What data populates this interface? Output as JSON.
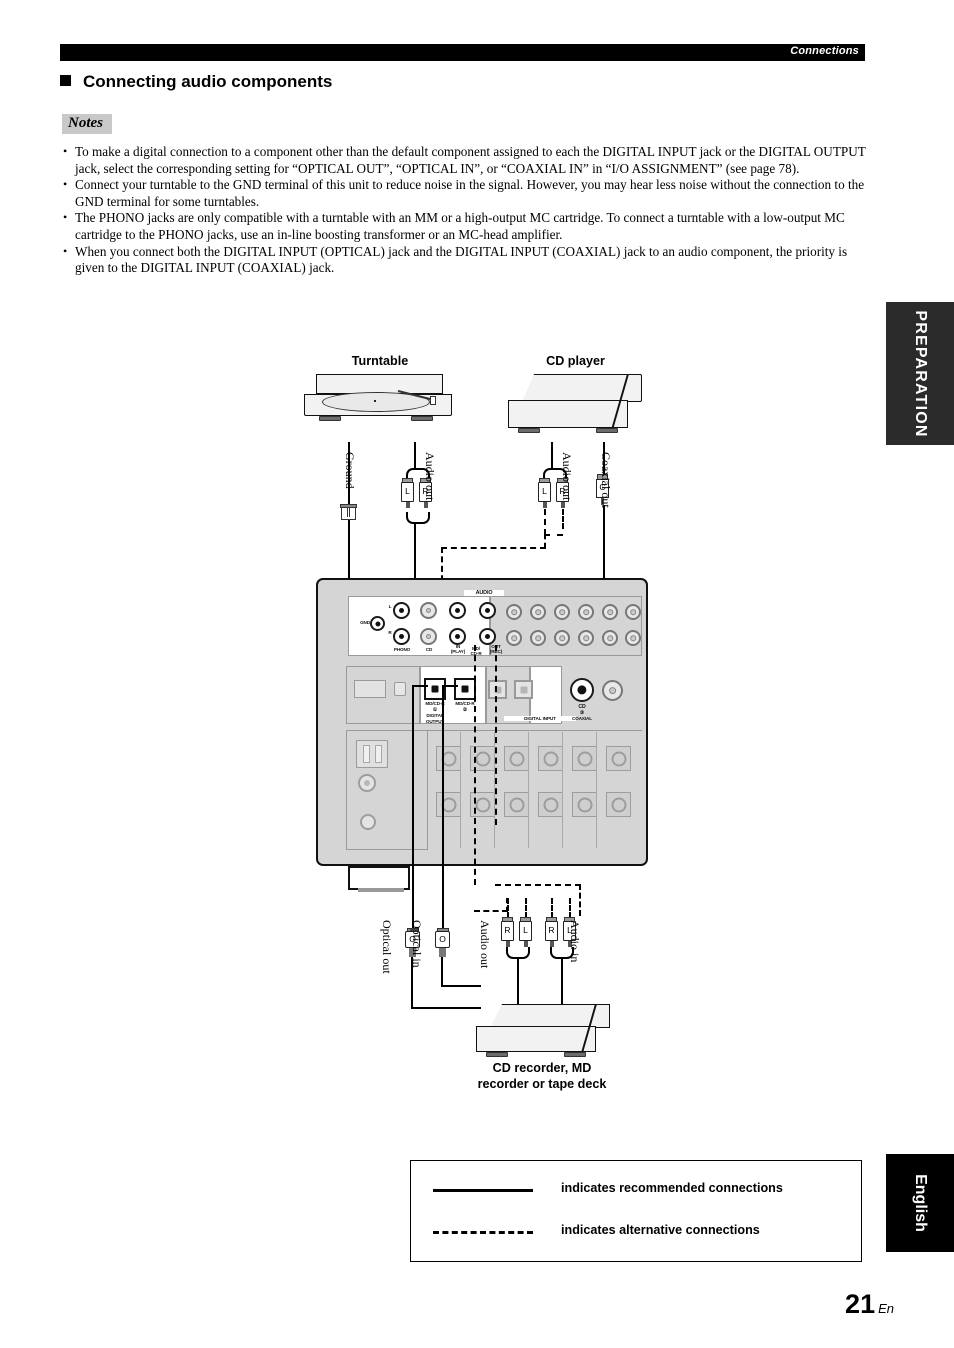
{
  "header": {
    "running_title": "Connections"
  },
  "section": {
    "title": "Connecting audio components"
  },
  "notes": {
    "label": "Notes",
    "items": [
      "To make a digital connection to a component other than the default component assigned to each the DIGITAL INPUT jack or the DIGITAL OUTPUT jack, select the corresponding setting for “OPTICAL OUT”, “OPTICAL IN”, or “COAXIAL IN” in “I/O ASSIGNMENT” (see page 78).",
      "Connect your turntable to the GND terminal of this unit to reduce noise in the signal. However, you may hear less noise without the connection to the GND terminal for some turntables.",
      "The PHONO jacks are only compatible with a turntable with an MM or a high-output MC cartridge. To connect a turntable with a low-output MC cartridge to the PHONO jacks, use an in-line boosting transformer or an MC-head amplifier.",
      "When you connect both the DIGITAL INPUT (OPTICAL) jack and the DIGITAL INPUT (COAXIAL) jack to an audio component, the priority is given to the DIGITAL INPUT (COAXIAL) jack."
    ]
  },
  "diagram": {
    "devices": {
      "turntable": "Turntable",
      "cd_player": "CD player",
      "recorder": "CD recorder, MD\nrecorder or tape deck"
    },
    "cable_labels": {
      "ground": "Ground",
      "audio_out_turntable": "Audio out",
      "audio_out_cd": "Audio out",
      "coaxial_out": "Coaxial out",
      "optical_out": "Optical out",
      "optical_in": "Optical in",
      "audio_out_rec": "Audio out",
      "audio_in_rec": "Audio in"
    },
    "plugs": {
      "left": "L",
      "right": "R",
      "coax": "C",
      "optical": "O"
    },
    "receiver_panel": {
      "audio": "AUDIO",
      "gnd": "GND",
      "phono": "PHONO",
      "cd": "CD",
      "in_play": "IN\n(PLAY)",
      "md_cdr": "MD/\nCD-R",
      "out_rec": "OUT\n(REC)",
      "digital_output": "DIGITAL\nOUTPUT",
      "digital_input": "DIGITAL INPUT",
      "opt_out_jack": "MD/CD-R",
      "opt_in_jack": "MD/CD-R",
      "coaxial": "COAXIAL",
      "coax_cd": "CD",
      "num1": "①",
      "num2": "②",
      "num3": "③",
      "num4": "④"
    }
  },
  "legend": {
    "recommended": "indicates recommended connections",
    "alternative": "indicates alternative connections"
  },
  "side_tabs": {
    "preparation": "PREPARATION",
    "english": "English"
  },
  "page": {
    "number": "21",
    "lang": "En"
  }
}
